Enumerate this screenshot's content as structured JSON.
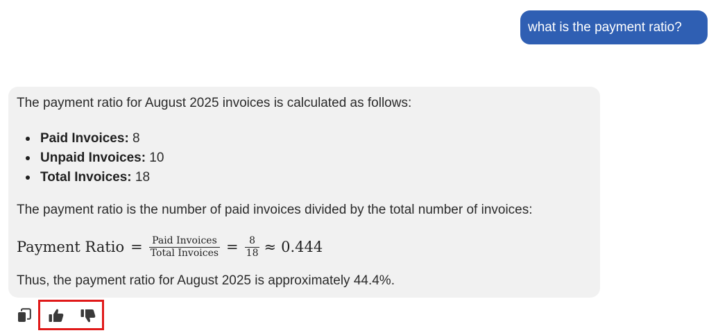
{
  "user_message": {
    "text": "what is the payment ratio?"
  },
  "assistant": {
    "intro": "The payment ratio for August 2025 invoices is calculated as follows:",
    "bullets": [
      {
        "label": "Paid Invoices:",
        "value": " 8"
      },
      {
        "label": "Unpaid Invoices:",
        "value": " 10"
      },
      {
        "label": "Total Invoices:",
        "value": " 18"
      }
    ],
    "explanation": "The payment ratio is the number of paid invoices divided by the total number of invoices:",
    "formula": {
      "lhs": "Payment Ratio",
      "eq": "=",
      "frac_num": "Paid Invoices",
      "frac_den": "Total Invoices",
      "eq2": "=",
      "num": "8",
      "den": "18",
      "approx": "≈",
      "result": "0.444"
    },
    "conclusion": "Thus, the payment ratio for August 2025 is approximately 44.4%."
  },
  "actions": {
    "icons": [
      "copy-icon",
      "thumbs-up-icon",
      "thumbs-down-icon"
    ],
    "highlight_color": "#e01919"
  },
  "colors": {
    "user_bubble": "#2f5fb3",
    "card_bg": "#f1f1f1"
  }
}
